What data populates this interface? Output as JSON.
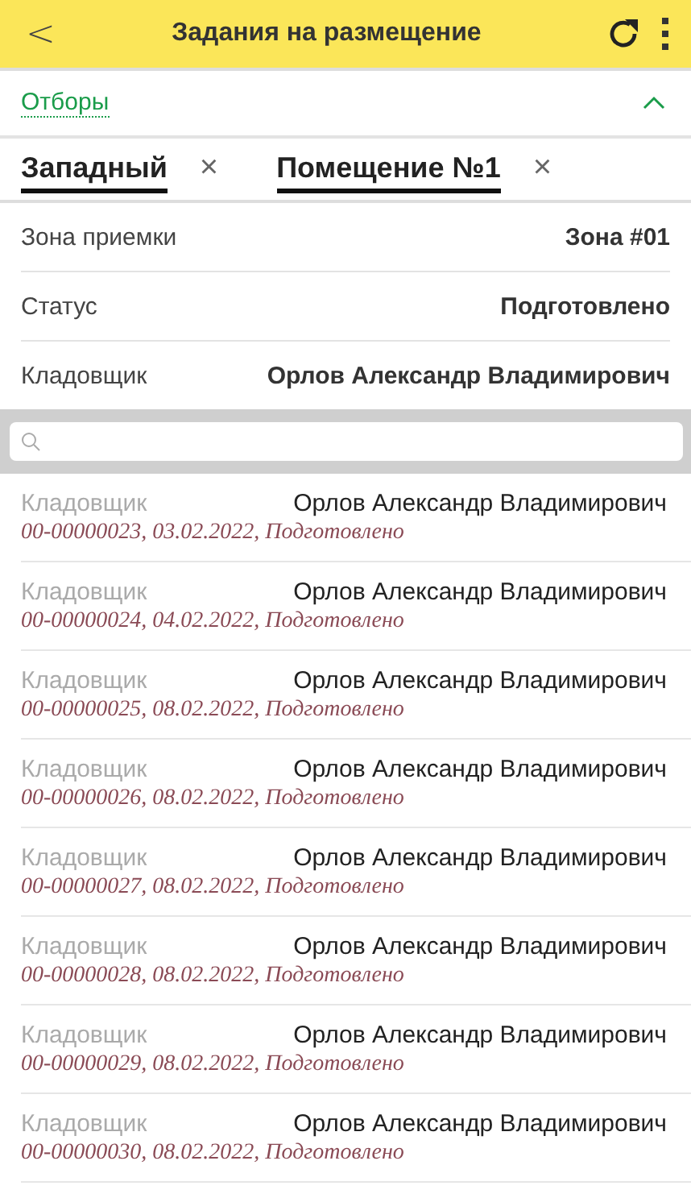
{
  "header": {
    "back": "<",
    "title": "Задания на размещение"
  },
  "filters": {
    "label": "Отборы",
    "expanded": true,
    "chips": [
      {
        "label": "Западный",
        "remove": "×"
      },
      {
        "label": "Помещение №1",
        "remove": "×"
      }
    ],
    "fields": [
      {
        "label": "Зона приемки",
        "value": "Зона #01"
      },
      {
        "label": "Статус",
        "value": "Подготовлено"
      },
      {
        "label": "Кладовщик",
        "value": "Орлов Александр Владимирович"
      }
    ]
  },
  "rows": [
    {
      "label": "Кладовщик",
      "value": "Орлов Александр Владимирович",
      "details": "00-00000023, 03.02.2022, Подготовлено"
    },
    {
      "label": "Кладовщик",
      "value": "Орлов Александр Владимирович",
      "details": "00-00000024, 04.02.2022, Подготовлено"
    },
    {
      "label": "Кладовщик",
      "value": "Орлов Александр Владимирович",
      "details": "00-00000025, 08.02.2022, Подготовлено"
    },
    {
      "label": "Кладовщик",
      "value": "Орлов Александр Владимирович",
      "details": "00-00000026, 08.02.2022, Подготовлено"
    },
    {
      "label": "Кладовщик",
      "value": "Орлов Александр Владимирович",
      "details": "00-00000027, 08.02.2022, Подготовлено"
    },
    {
      "label": "Кладовщик",
      "value": "Орлов Александр Владимирович",
      "details": "00-00000028, 08.02.2022, Подготовлено"
    },
    {
      "label": "Кладовщик",
      "value": "Орлов Александр Владимирович",
      "details": "00-00000029, 08.02.2022, Подготовлено"
    },
    {
      "label": "Кладовщик",
      "value": "Орлов Александр Владимирович",
      "details": "00-00000030, 08.02.2022, Подготовлено"
    }
  ]
}
